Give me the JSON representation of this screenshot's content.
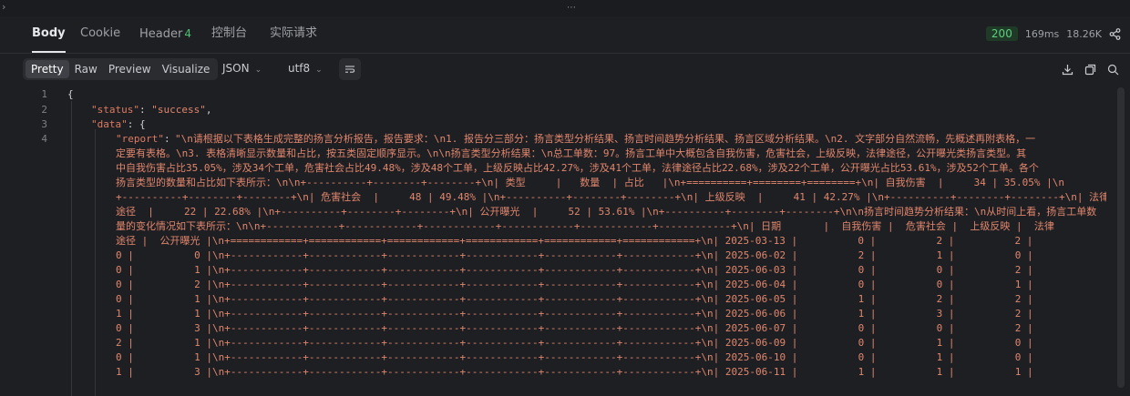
{
  "tabs": [
    {
      "label": "Body"
    },
    {
      "label": "Cookie"
    },
    {
      "label": "Header",
      "count": "4"
    },
    {
      "label": "控制台"
    },
    {
      "label": "实际请求"
    }
  ],
  "status": {
    "code": "200",
    "time": "169ms",
    "size": "18.26K"
  },
  "toolbar": {
    "views": [
      "Pretty",
      "Raw",
      "Preview",
      "Visualize"
    ],
    "format": "JSON",
    "encoding": "utf8"
  },
  "icons": {
    "share": "share-icon",
    "wrap": "wrap-lines-icon",
    "download": "download-icon",
    "copy": "copy-icon",
    "search": "search-icon"
  },
  "editor": {
    "line_numbers": [
      "1",
      "2",
      "3",
      "4"
    ],
    "line1": "{",
    "status_key": "\"status\"",
    "status_val": "\"success\"",
    "data_key": "\"data\"",
    "report_key": "\"report\"",
    "report_lines": [
      "\"\\n请根据以下表格生成完整的扬言分析报告，报告要求：\\n1. 报告分三部分：扬言类型分析结果、扬言时间趋势分析结果、扬言区域分析结果。\\n2. 文字部分自然流畅，先概述再附表格，一",
      "定要有表格。\\n3. 表格清晰显示数量和占比，按五类固定顺序显示。\\n\\n扬言类型分析结果：\\n总工单数：97。扬言工单中大概包含自我伤害，危害社会，上级反映，法律途径，公开曝光类扬言类型。其",
      "中自我伤害占比35.05%，涉及34个工单，危害社会占比49.48%，涉及48个工单，上级反映占比42.27%，涉及41个工单，法律途径占比22.68%，涉及22个工单，公开曝光占比53.61%，涉及52个工单。各个",
      "扬言类型的数量和占比如下表所示：\\n\\n+----------+--------+--------+\\n| 类型     |   数量  | 占比   |\\n+==========+========+========+\\n| 自我伤害  |     34 | 35.05% |\\n",
      "+----------+--------+--------+\\n| 危害社会  |     48 | 49.48% |\\n+----------+--------+--------+\\n| 上级反映  |     41 | 42.27% |\\n+----------+--------+--------+\\n| 法律",
      "途径  |     22 | 22.68% |\\n+----------+--------+--------+\\n| 公开曝光  |     52 | 53.61% |\\n+----------+--------+--------+\\n\\n扬言时间趋势分析结果：\\n从时间上看，扬言工单数",
      "量的变化情况如下表所示：\\n\\n+------------+------------+------------+------------+------------+------------+\\n| 日期       |  自我伤害 |  危害社会 |  上级反映 |  法律",
      "途径 |  公开曝光 |\\n+============+============+============+============+============+============+\\n| 2025-03-13 |          0 |          2 |          2 |",
      "0 |          0 |\\n+------------+------------+------------+------------+------------+------------+\\n| 2025-06-02 |          2 |          1 |          0 |",
      "0 |          1 |\\n+------------+------------+------------+------------+------------+------------+\\n| 2025-06-03 |          0 |          0 |          2 |",
      "0 |          2 |\\n+------------+------------+------------+------------+------------+------------+\\n| 2025-06-04 |          0 |          0 |          1 |",
      "0 |          1 |\\n+------------+------------+------------+------------+------------+------------+\\n| 2025-06-05 |          1 |          2 |          2 |",
      "1 |          1 |\\n+------------+------------+------------+------------+------------+------------+\\n| 2025-06-06 |          1 |          3 |          2 |",
      "0 |          3 |\\n+------------+------------+------------+------------+------------+------------+\\n| 2025-06-07 |          0 |          0 |          2 |",
      "2 |          1 |\\n+------------+------------+------------+------------+------------+------------+\\n| 2025-06-09 |          0 |          1 |          0 |",
      "0 |          1 |\\n+------------+------------+------------+------------+------------+------------+\\n| 2025-06-10 |          0 |          1 |          0 |",
      "1 |          3 |\\n+------------+------------+------------+------------+------------+------------+\\n| 2025-06-11 |          1 |          1 |          1 |"
    ]
  }
}
